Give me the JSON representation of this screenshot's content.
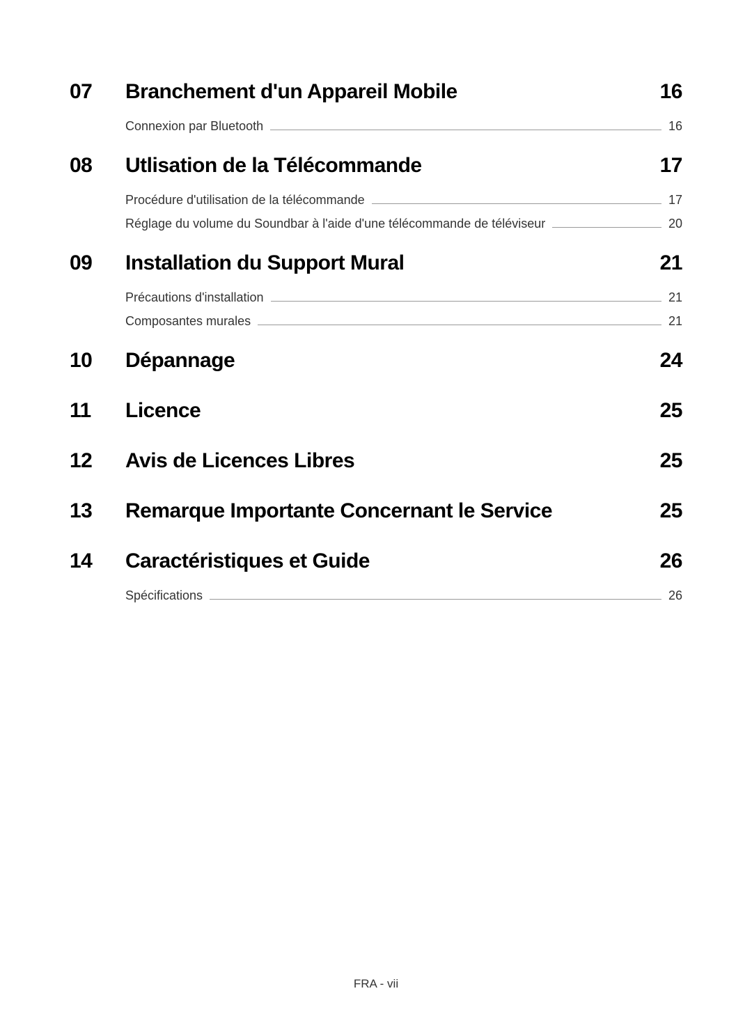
{
  "sections": [
    {
      "number": "07",
      "title": "Branchement d'un Appareil Mobile",
      "page": "16",
      "subs": [
        {
          "title": "Connexion par Bluetooth",
          "page": "16"
        }
      ]
    },
    {
      "number": "08",
      "title": "Utlisation de la Télécommande",
      "page": "17",
      "subs": [
        {
          "title": "Procédure d'utilisation de la télécommande",
          "page": "17"
        },
        {
          "title": "Réglage du volume du Soundbar à l'aide d'une télécommande de téléviseur",
          "page": "20"
        }
      ]
    },
    {
      "number": "09",
      "title": "Installation du Support Mural",
      "page": "21",
      "subs": [
        {
          "title": "Précautions d'installation",
          "page": "21"
        },
        {
          "title": "Composantes murales",
          "page": "21"
        }
      ]
    },
    {
      "number": "10",
      "title": "Dépannage",
      "page": "24",
      "subs": []
    },
    {
      "number": "11",
      "title": "Licence",
      "page": "25",
      "subs": []
    },
    {
      "number": "12",
      "title": "Avis de Licences Libres",
      "page": "25",
      "subs": []
    },
    {
      "number": "13",
      "title": "Remarque Importante Concernant le Service",
      "page": "25",
      "subs": []
    },
    {
      "number": "14",
      "title": "Caractéristiques et Guide",
      "page": "26",
      "subs": [
        {
          "title": "Spécifications",
          "page": "26"
        }
      ]
    }
  ],
  "footer": "FRA - vii"
}
